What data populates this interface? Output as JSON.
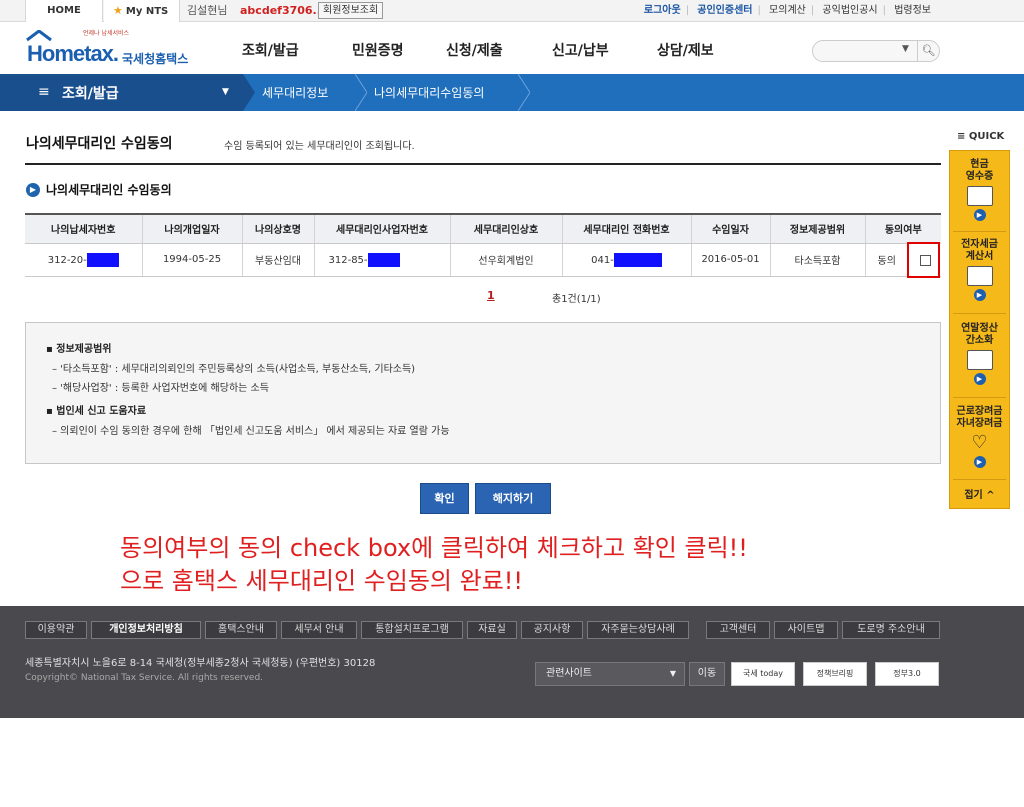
{
  "topbar": {
    "home": "HOME",
    "mynts": "My NTS",
    "user_name": "김설현님",
    "user_id": "abcdef3706...",
    "member_button": "회원정보조회",
    "links": [
      "로그아웃",
      "공인인증센터",
      "모의계산",
      "공익법인공시",
      "법령정보"
    ]
  },
  "header": {
    "logo_small": "언제나 납세서비스",
    "logo_brand": "Hometax.",
    "logo_korean": "국세청홈택스",
    "menu": [
      "조회/발급",
      "민원증명",
      "신청/제출",
      "신고/납부",
      "상담/제보"
    ],
    "search_placeholder": ""
  },
  "navbar": {
    "menu_label": "조회/발급",
    "breadcrumb": [
      "세무대리정보",
      "나의세무대리수임동의"
    ]
  },
  "page": {
    "title": "나의세무대리인 수임동의",
    "description": "수임 등록되어 있는 세무대리인이 조회됩니다.",
    "section_title": "나의세무대리인 수임동의"
  },
  "table": {
    "headers": [
      "나의납세자번호",
      "나의개업일자",
      "나의상호명",
      "세무대리인사업자번호",
      "세무대리인상호",
      "세무대리인 전화번호",
      "수임일자",
      "정보제공범위",
      "동의여부"
    ],
    "row": {
      "taxpayer_no": "312-20-",
      "open_date": "1994-05-25",
      "company": "부동산임대",
      "agent_biz_no": "312-85-",
      "agent_name": "선우회계법인",
      "agent_phone": "041-",
      "date": "2016-05-01",
      "scope": "타소득포함",
      "consent": "동의"
    }
  },
  "pagination": {
    "current": "1",
    "total": "총1건(1/1)"
  },
  "info": {
    "h1": "정보제공범위",
    "l1": "– '타소득포함' : 세무대리의뢰인의 주민등록상의 소득(사업소득, 부동산소득, 기타소득)",
    "l2": "– '해당사업장' : 등록한 사업자번호에 해당하는 소득",
    "h2": "법인세 신고 도움자료",
    "l3": "– 의뢰인이 수임 동의한 경우에 한해 「법인세 신고도움 서비스」 에서 제공되는 자료 열람 가능"
  },
  "buttons": {
    "confirm": "확인",
    "revoke": "해지하기"
  },
  "annotation": {
    "line1": "동의여부의 동의 check box에 클릭하여 체크하고 확인 클릭!!",
    "line2": "으로 홈택스 세무대리인 수임동의 완료!!",
    "color": "#e02020"
  },
  "quick": {
    "title": "QUICK",
    "items": [
      {
        "line1": "현금",
        "line2": "영수증",
        "icon": "receipt-icon"
      },
      {
        "line1": "전자세금",
        "line2": "계산서",
        "icon": "invoice-icon"
      },
      {
        "line1": "연말정산",
        "line2": "간소화",
        "icon": "document-icon"
      },
      {
        "line1": "근로장려금",
        "line2": "자녀장려금",
        "icon": "heart-icon"
      }
    ],
    "fold": "접기"
  },
  "footer": {
    "links": [
      "이용약관",
      "개인정보처리방침",
      "홈택스안내",
      "세무서 안내",
      "통합설치프로그램",
      "자료실",
      "공지사항",
      "자주묻는상담사례",
      "고객센터",
      "사이트맵",
      "도로명 주소안내"
    ],
    "address": "세종특별자치시 노을6로 8-14 국세청(정부세종2청사 국세청동) (우편번호) 30128",
    "copyright": "Copyright© National Tax Service. All rights reserved.",
    "related_site": "관련사이트",
    "go": "이동",
    "banners": [
      "국세 today",
      "정책브리핑",
      "정부3.0"
    ]
  },
  "colors": {
    "brand_blue": "#1f6fbd",
    "nav_dark": "#1a4f8e",
    "quick_yellow": "#f6b91a",
    "highlight_red": "#e00000",
    "mask_blue": "#1010ff"
  }
}
